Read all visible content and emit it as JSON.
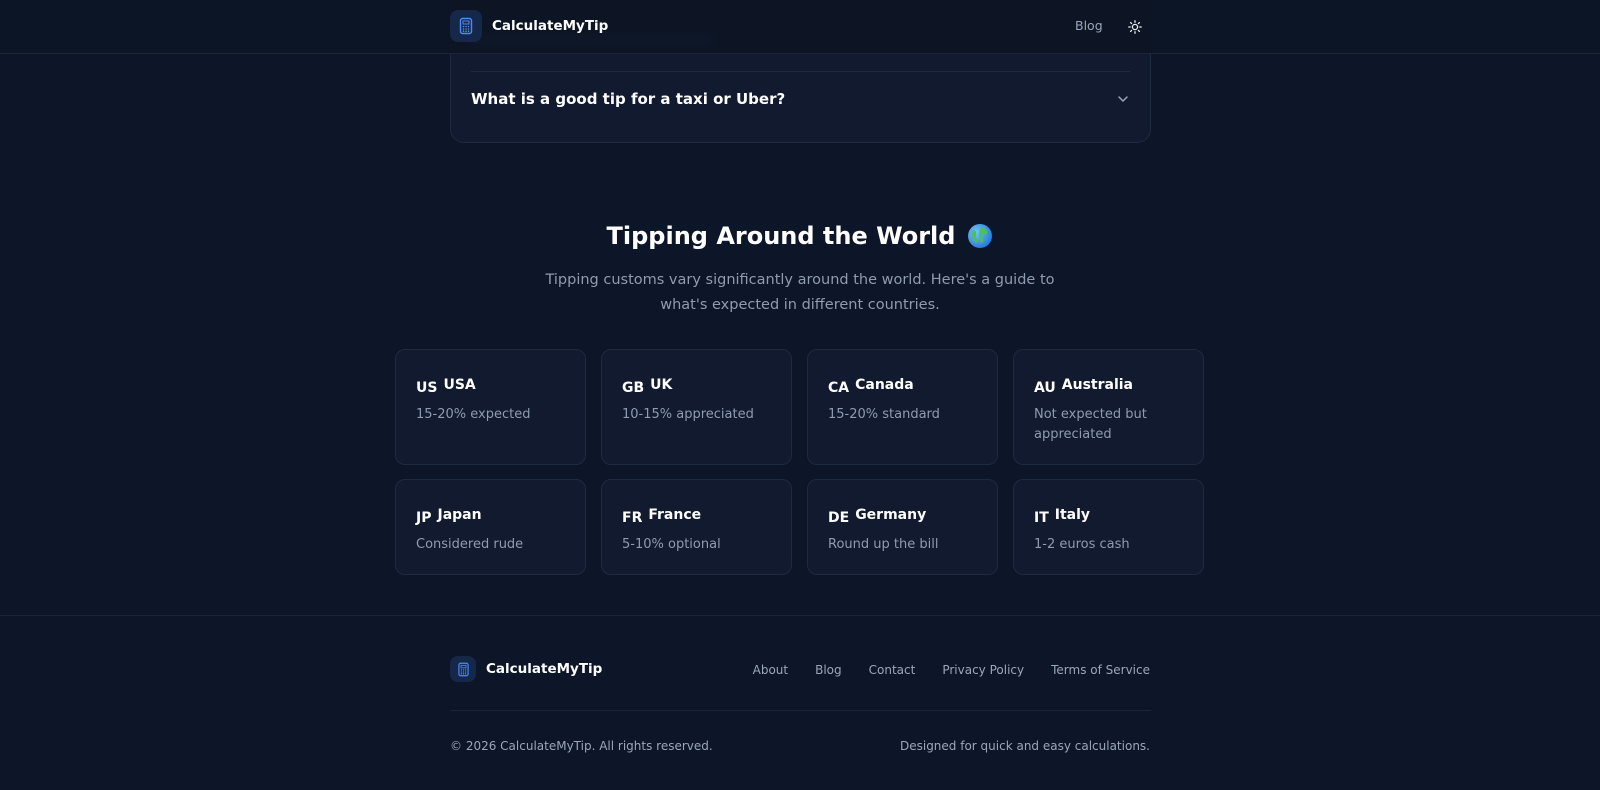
{
  "header": {
    "brand": "CalculateMyTip",
    "nav_blog": "Blog",
    "theme_icon": "sun-icon"
  },
  "faq": {
    "question": "What is a good tip for a taxi or Uber?"
  },
  "world": {
    "title": "Tipping Around the World",
    "title_icon": "globe-icon",
    "subtitle": "Tipping customs vary significantly around the world. Here's a guide to what's expected in different countries.",
    "countries": [
      {
        "code": "US",
        "name": "USA",
        "note": "15-20% expected"
      },
      {
        "code": "GB",
        "name": "UK",
        "note": "10-15% appreciated"
      },
      {
        "code": "CA",
        "name": "Canada",
        "note": "15-20% standard"
      },
      {
        "code": "AU",
        "name": "Australia",
        "note": "Not expected but appreciated"
      },
      {
        "code": "JP",
        "name": "Japan",
        "note": "Considered rude"
      },
      {
        "code": "FR",
        "name": "France",
        "note": "5-10% optional"
      },
      {
        "code": "DE",
        "name": "Germany",
        "note": "Round up the bill"
      },
      {
        "code": "IT",
        "name": "Italy",
        "note": "1-2 euros cash"
      }
    ]
  },
  "footer": {
    "brand": "CalculateMyTip",
    "links": [
      "About",
      "Blog",
      "Contact",
      "Privacy Policy",
      "Terms of Service"
    ],
    "copyright": "© 2026 CalculateMyTip. All rights reserved.",
    "tagline": "Designed for quick and easy calculations."
  },
  "colors": {
    "background": "#0d1628",
    "card": "#111a2e",
    "accent": "#3b82f6",
    "muted_text": "#8f9bb0"
  }
}
